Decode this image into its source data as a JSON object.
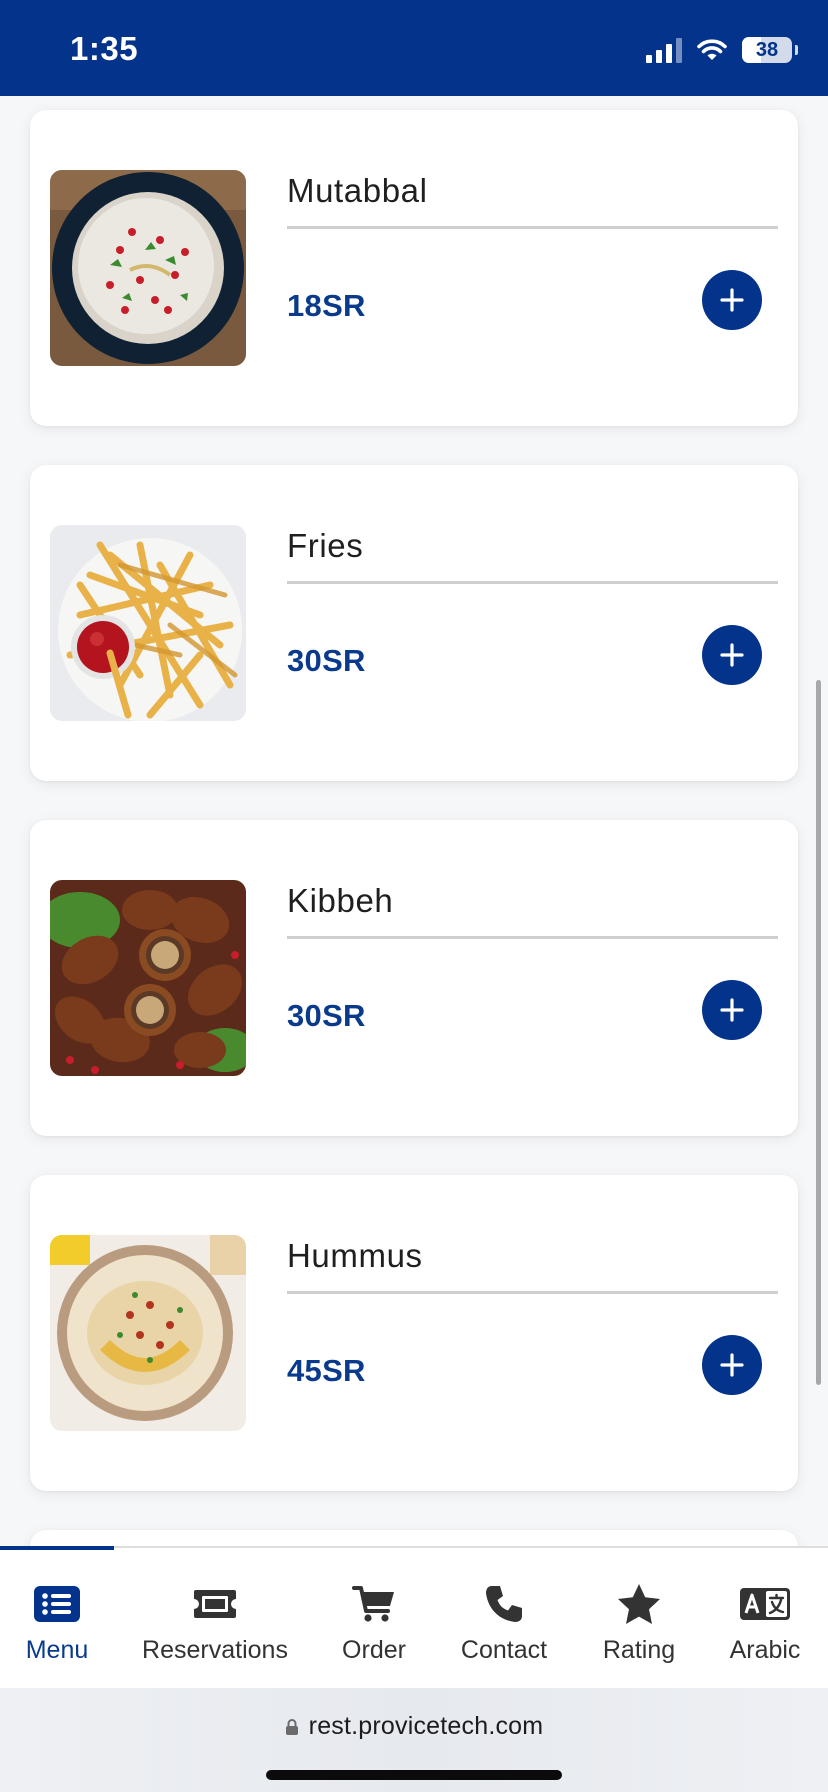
{
  "status_bar": {
    "time": "1:35",
    "battery": "38"
  },
  "menu_items": [
    {
      "name": "Mutabbal",
      "price": "18SR",
      "image": "mutabbal-photo"
    },
    {
      "name": "Fries",
      "price": "30SR",
      "image": "fries-photo"
    },
    {
      "name": "Kibbeh",
      "price": "30SR",
      "image": "kibbeh-photo"
    },
    {
      "name": "Hummus",
      "price": "45SR",
      "image": "hummus-photo"
    }
  ],
  "bottom_nav": {
    "items": [
      {
        "label": "Menu",
        "icon": "list-icon",
        "active": true
      },
      {
        "label": "Reservations",
        "icon": "ticket-icon"
      },
      {
        "label": "Order",
        "icon": "cart-icon"
      },
      {
        "label": "Contact",
        "icon": "phone-icon"
      },
      {
        "label": "Rating",
        "icon": "star-icon"
      },
      {
        "label": "Arabic",
        "icon": "language-icon"
      }
    ]
  },
  "browser": {
    "url": "rest.provicetech.com"
  },
  "colors": {
    "brand": "#03338a",
    "price": "#0a3a8c"
  }
}
